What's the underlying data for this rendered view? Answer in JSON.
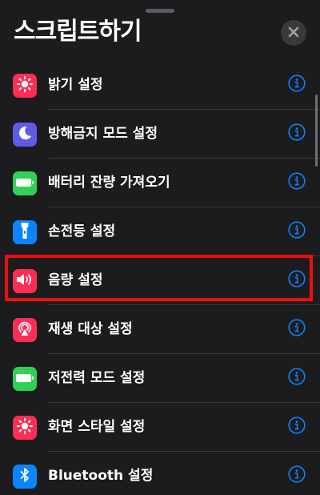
{
  "header": {
    "title": "스크립트하기"
  },
  "colors": {
    "accent": "#0a84ff",
    "highlight": "#f00d0d",
    "background": "#1c1c1e"
  },
  "actions": [
    {
      "label": "밝기 설정",
      "icon": "sun-icon",
      "icon_bg": "#ff2d55"
    },
    {
      "label": "방해금지 모드 설정",
      "icon": "moon-icon",
      "icon_bg": "#5e5ce6"
    },
    {
      "label": "배터리 잔량 가져오기",
      "icon": "battery-icon",
      "icon_bg": "#30d158"
    },
    {
      "label": "손전등 설정",
      "icon": "flashlight-icon",
      "icon_bg": "#0a84ff"
    },
    {
      "label": "음량 설정",
      "icon": "speaker-icon",
      "icon_bg": "#ff2d55",
      "highlighted": true
    },
    {
      "label": "재생 대상 설정",
      "icon": "airplay-audio-icon",
      "icon_bg": "#ff2d55"
    },
    {
      "label": "저전력 모드 설정",
      "icon": "battery-icon",
      "icon_bg": "#30d158"
    },
    {
      "label": "화면 스타일 설정",
      "icon": "sun-icon",
      "icon_bg": "#ff2d55"
    },
    {
      "label": "Bluetooth 설정",
      "icon": "bluetooth-icon",
      "icon_bg": "#0a84ff"
    }
  ]
}
